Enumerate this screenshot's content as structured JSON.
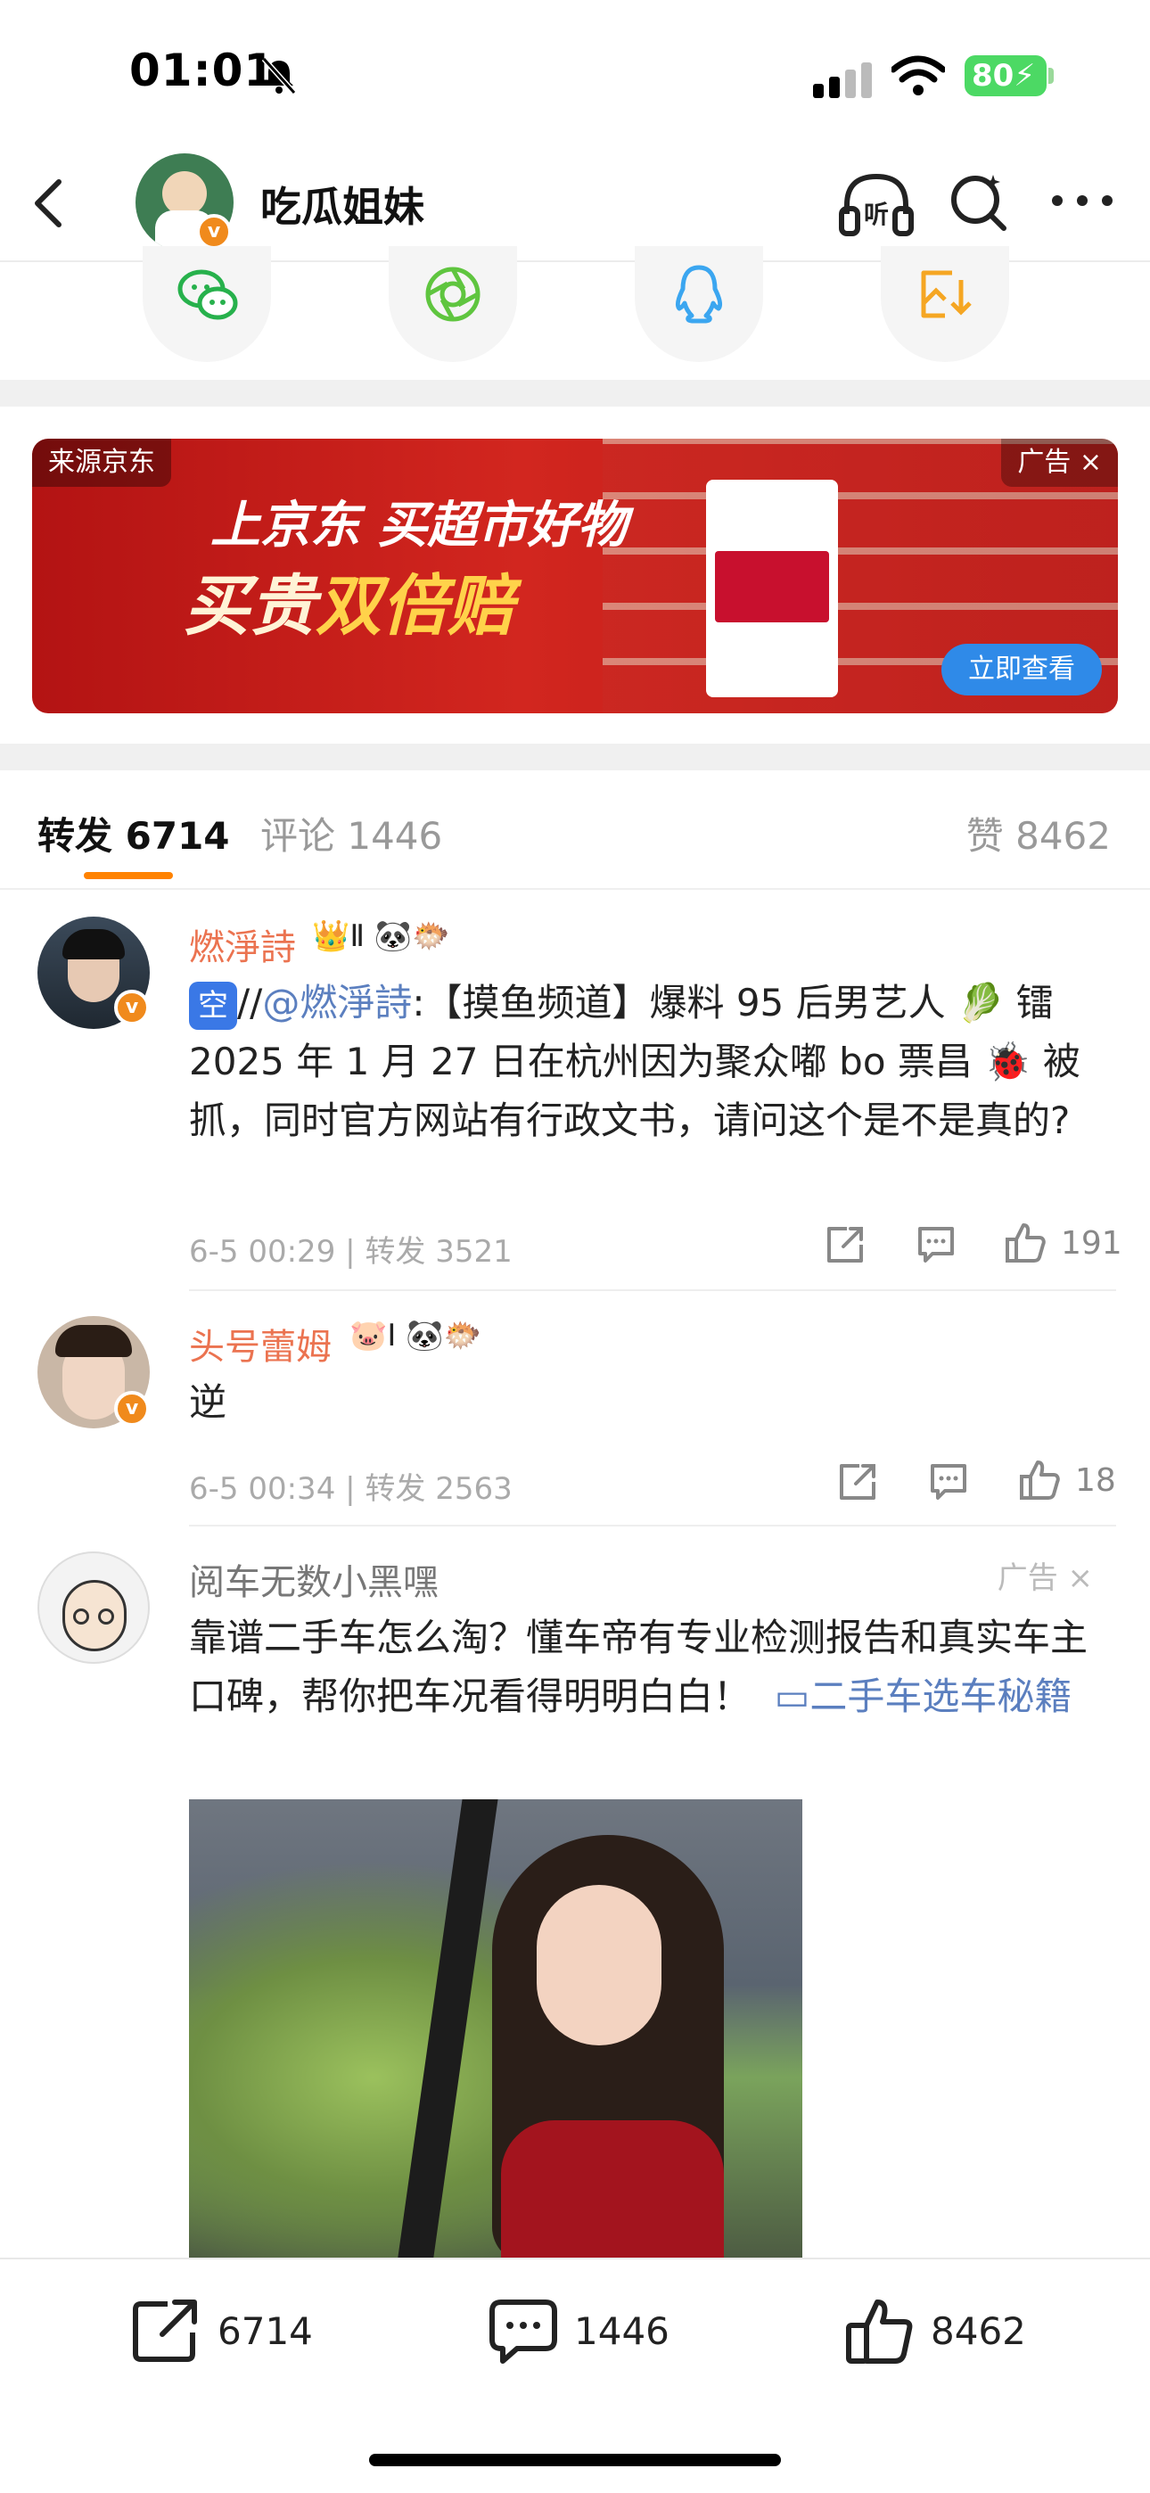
{
  "status_bar": {
    "time": "01:01",
    "battery": "80"
  },
  "header": {
    "title": "吃瓜姐妹",
    "avatar_badge": "v"
  },
  "share": {
    "icons": [
      "wechat-icon",
      "moments-icon",
      "qq-icon",
      "save-image-icon"
    ]
  },
  "ad_banner": {
    "source": "来源京东",
    "tag": "广告 ×",
    "headline_1": "上京东 买超市好物",
    "headline_2a": "买贵",
    "headline_2b": "双倍赔",
    "cta": "立即查看"
  },
  "tabs": {
    "repost": "转发 6714",
    "comment": "评论 1446",
    "like": "赞 8462"
  },
  "comments": [
    {
      "name": "燃淨詩",
      "badges": "👑Ⅱ 🐼🐡",
      "kong": "空",
      "prefix": "//",
      "mention": "@燃淨詩",
      "text": ":【摸鱼频道】爆料 95 后男艺人 🥬 镭 2025 年 1 月 27 日在杭州因为聚众嘟 bo 票昌 🐞 被抓，同时官方网站有行政文书，请问这个是不是真的?",
      "meta": "6-5 00:29 | 转发 3521",
      "likes": "191"
    },
    {
      "name": "头号蕾姆",
      "badges": "🐷Ⅰ 🐼🐡",
      "text": "逆",
      "meta": "6-5 00:34 | 转发 2563",
      "likes": "18"
    }
  ],
  "ad_post": {
    "author": "阅车无数小黑嘿",
    "label": "广告 ×",
    "text": "靠谱二手车怎么淘？懂车帝有专业检测报告和真实车主口碑，帮你把车况看得明明白白！",
    "link": "▭二手车选车秘籍"
  },
  "bottom_bar": {
    "repost_count": "6714",
    "comment_count": "1446",
    "like_count": "8462"
  },
  "colors": {
    "accent_orange": "#ff8200",
    "username_orange": "#eb7350",
    "link_blue": "#5b7fbf"
  }
}
